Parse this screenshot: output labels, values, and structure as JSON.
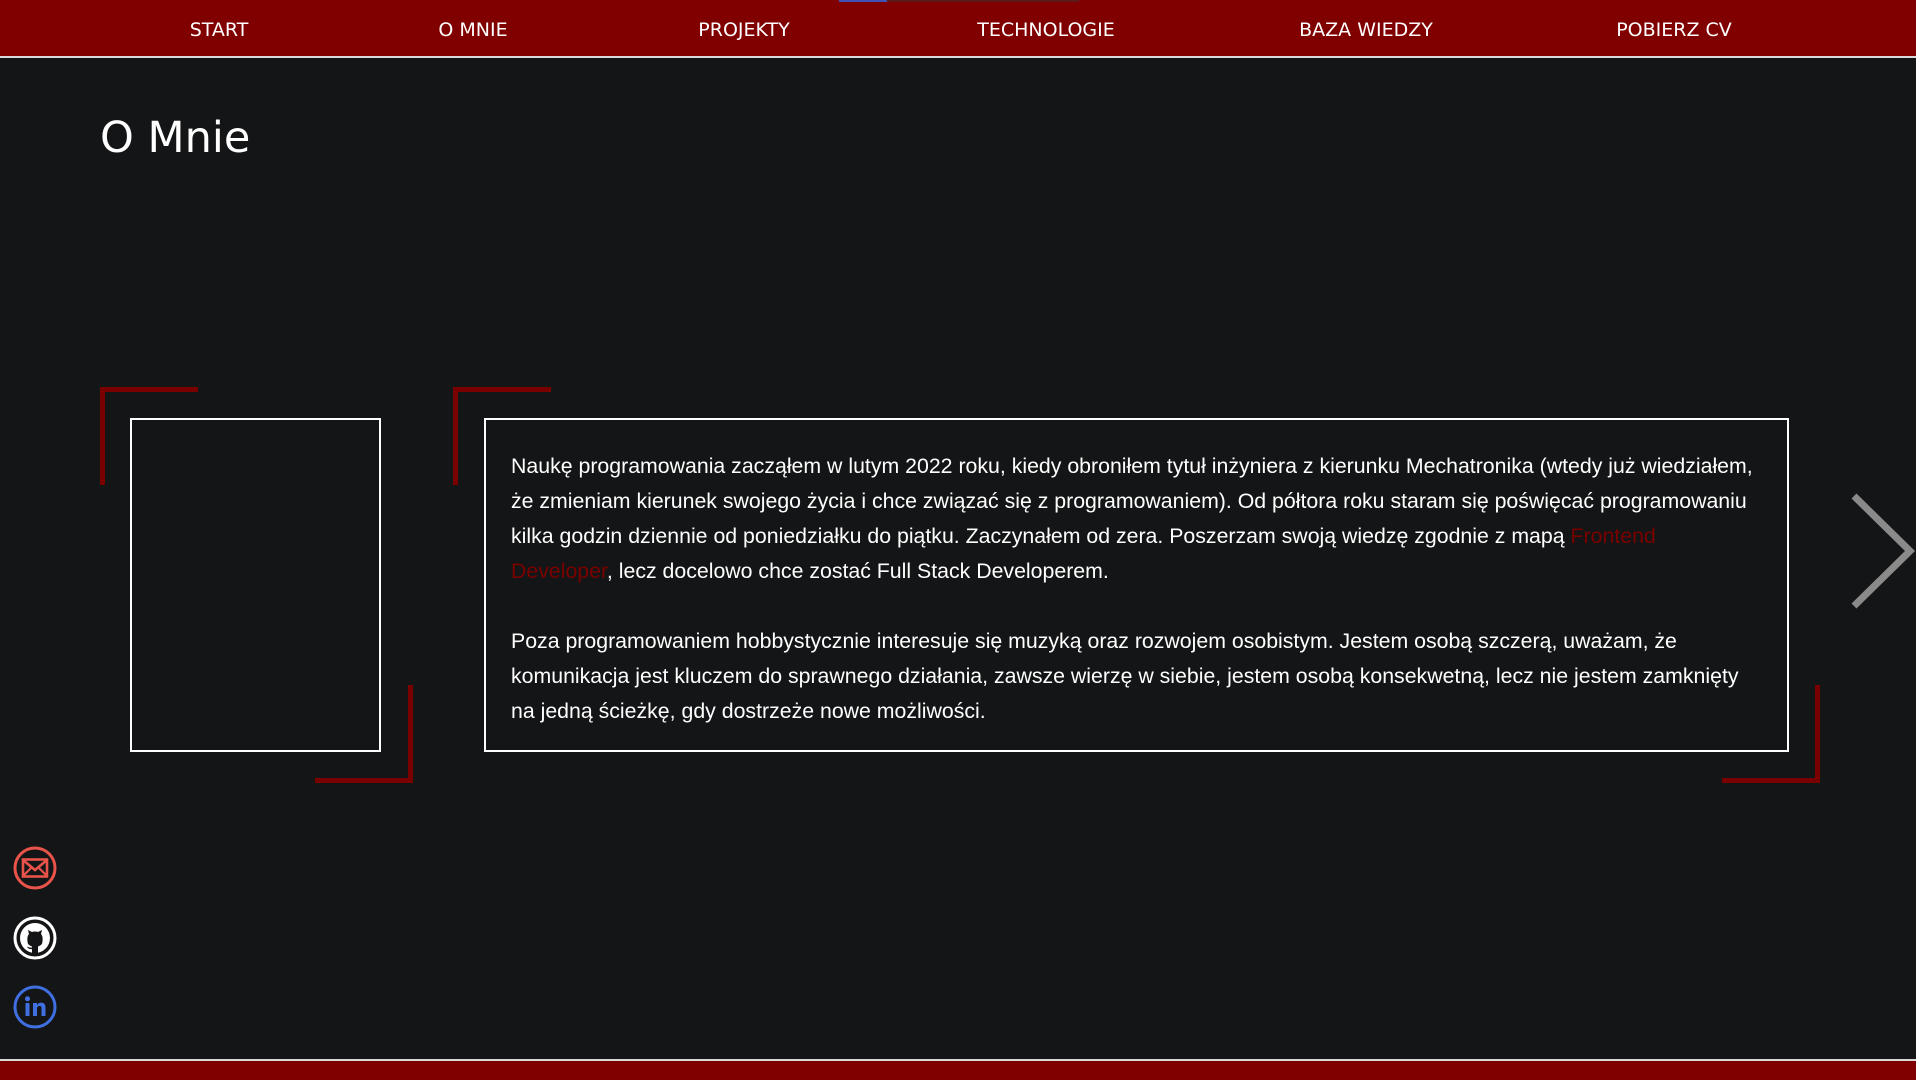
{
  "nav": {
    "items": [
      {
        "label": "START"
      },
      {
        "label": "O MNIE"
      },
      {
        "label": "PROJEKTY"
      },
      {
        "label": "TECHNOLOGIE"
      },
      {
        "label": "BAZA WIEDZY"
      },
      {
        "label": "POBIERZ CV"
      }
    ],
    "scroll_progress": 0.2
  },
  "page": {
    "title": "O Mnie"
  },
  "about": {
    "paragraph1": {
      "before_link": "Naukę programowania zacząłem w lutym 2022 roku, kiedy obroniłem tytuł inżyniera z kierunku Mechatronika (wtedy już wiedziałem, że zmieniam kierunek swojego życia i chce związać się z programowaniem). Od półtora roku staram się poświęcać programowaniu kilka godzin dziennie od poniedziałku do piątku. Zaczynałem od zera. Poszerzam swoją wiedzę zgodnie z mapą ",
      "link_text": "Frontend Developer",
      "after_link": ", lecz docelowo chce zostać Full Stack Developerem."
    },
    "paragraph2": "Poza programowaniem hobbystycznie interesuje się muzyką oraz rozwojem osobistym. Jestem osobą szczerą, uważam, że komunikacja jest kluczem do sprawnego działania, zawsze wierzę w siebie, jestem osobą konsekwetną, lecz nie jestem zamknięty na jedną ścieżkę, gdy dostrzeże nowe możliwości."
  },
  "icons": {
    "next": "chevron-right-icon",
    "email": "envelope-icon",
    "github": "github-icon",
    "linkedin": "linkedin-icon"
  },
  "colors": {
    "brand": "#800000",
    "accent_dark": "#7a0000",
    "background": "#141516",
    "text": "#ffffff",
    "email_icon": "#e8534a",
    "linkedin_icon": "#3f6fe0",
    "progress": "#3f51b5"
  }
}
